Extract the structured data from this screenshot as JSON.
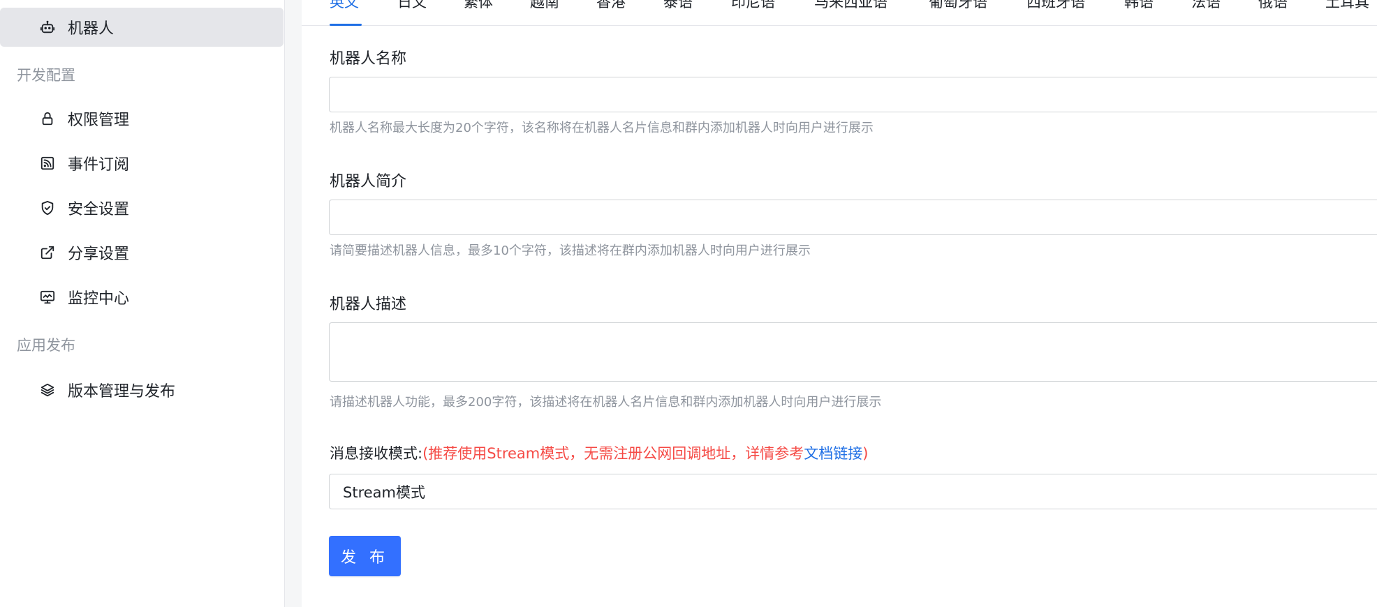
{
  "sidebar": {
    "active_item": {
      "label": "机器人",
      "icon": "robot-icon"
    },
    "groups": [
      {
        "title": "开发配置",
        "items": [
          {
            "label": "权限管理",
            "icon": "lock-icon"
          },
          {
            "label": "事件订阅",
            "icon": "rss-icon"
          },
          {
            "label": "安全设置",
            "icon": "shield-check-icon"
          },
          {
            "label": "分享设置",
            "icon": "external-link-icon"
          },
          {
            "label": "监控中心",
            "icon": "monitor-icon"
          }
        ]
      },
      {
        "title": "应用发布",
        "items": [
          {
            "label": "版本管理与发布",
            "icon": "layers-icon"
          }
        ]
      }
    ]
  },
  "language_tabs": [
    "英文",
    "日文",
    "繁体",
    "越南",
    "香港",
    "泰语",
    "印尼语",
    "马来西亚语",
    "葡萄牙语",
    "西班牙语",
    "韩语",
    "法语",
    "俄语",
    "土耳其"
  ],
  "form": {
    "name": {
      "label": "机器人名称",
      "value": "",
      "hint": "机器人名称最大长度为20个字符，该名称将在机器人名片信息和群内添加机器人时向用户进行展示"
    },
    "intro": {
      "label": "机器人简介",
      "value": "",
      "hint": "请简要描述机器人信息，最多10个字符，该描述将在群内添加机器人时向用户进行展示"
    },
    "description": {
      "label": "机器人描述",
      "value": "",
      "hint": "请描述机器人功能，最多200字符，该描述将在机器人名片信息和群内添加机器人时向用户进行展示"
    },
    "message_mode": {
      "label": "消息接收模式:",
      "note_prefix": "(推荐使用Stream模式，无需注册公网回调地址，详情参考",
      "link_text": "文档链接",
      "note_suffix": ")",
      "selected": "Stream模式"
    },
    "publish_label": "发 布"
  },
  "colors": {
    "accent": "#1f6fe5",
    "button": "#3370ff",
    "warning_text": "#f54a45",
    "hint_text": "#8f959e",
    "active_nav_bg": "#e5e6ea"
  }
}
